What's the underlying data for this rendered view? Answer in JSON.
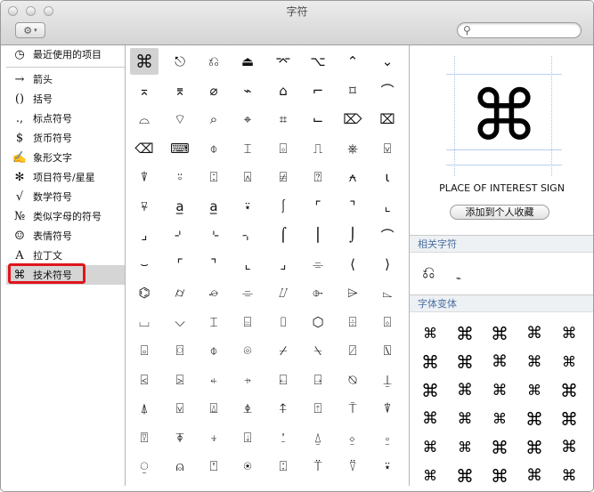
{
  "window": {
    "title": "字符"
  },
  "toolbar": {
    "gear_icon": "⚙",
    "caret": "▾",
    "search_placeholder": ""
  },
  "sidebar": {
    "items": [
      {
        "icon": "◷",
        "label": "最近使用的项目",
        "name": "recent"
      },
      {
        "icon": "→",
        "label": "箭头",
        "name": "arrows"
      },
      {
        "icon": "()",
        "label": "括号",
        "name": "brackets"
      },
      {
        "icon": ".,",
        "label": "标点符号",
        "name": "punctuation"
      },
      {
        "icon": "$",
        "label": "货币符号",
        "name": "currency"
      },
      {
        "icon": "✍",
        "label": "象形文字",
        "name": "pictographs"
      },
      {
        "icon": "✻",
        "label": "项目符号/星星",
        "name": "bullets-stars"
      },
      {
        "icon": "√",
        "label": "数学符号",
        "name": "math"
      },
      {
        "icon": "№",
        "label": "类似字母的符号",
        "name": "letterlike"
      },
      {
        "icon": "☺",
        "label": "表情符号",
        "name": "emoticons"
      },
      {
        "icon": "A",
        "label": "拉丁文",
        "name": "latin"
      },
      {
        "icon": "⌘",
        "label": "技术符号",
        "name": "technical"
      }
    ],
    "selected_index": 11
  },
  "grid": {
    "rows": [
      [
        "⌘",
        "⎋",
        "⎌",
        "⏏",
        "⌤",
        "⌥",
        "⌃",
        "⌄"
      ],
      [
        "⌅",
        "⌆",
        "⌀",
        "⌁",
        "⌂",
        "⌐",
        "⌑",
        "⌒"
      ],
      [
        "⌓",
        "⌔",
        "⌕",
        "⌖",
        "⌗",
        "⌙",
        "⌦",
        "⌧"
      ],
      [
        "⌫",
        "⌨",
        "⌽",
        "⌶",
        "⌺",
        "⎍",
        "⎈",
        "⍌"
      ],
      [
        "⍒",
        "⍤",
        "⍠",
        "⍓",
        "⍯",
        "⍰",
        "⍲",
        "⍳"
      ],
      [
        "⍫",
        "a̲",
        "a̲",
        "⍣",
        "⎰",
        "⌜",
        "⌝",
        "⌞"
      ],
      [
        "⌟",
        "⌏",
        "⌎",
        "⌍",
        "⌠",
        "⎮",
        "⌡",
        "⌒"
      ],
      [
        "⌣",
        "⌜",
        "⌝",
        "⌞",
        "⌟",
        "⌯",
        "⟨",
        "⟩"
      ],
      [
        "⌬",
        "⌭",
        "⌮",
        "⌯",
        "⌰",
        "⌱",
        "⌲",
        "⌳"
      ],
      [
        "⌴",
        "⌵",
        "⌶",
        "⌸",
        "⌷",
        "⬡",
        "⌹",
        "⌺"
      ],
      [
        "⌻",
        "⌼",
        "⌽",
        "⌾",
        "⌿",
        "⍀",
        "⍁",
        "⍂"
      ],
      [
        "⍃",
        "⍄",
        "⍅",
        "⍆",
        "⍇",
        "⍈",
        "⍉",
        "⍊"
      ],
      [
        "⍋",
        "⍌",
        "⍍",
        "⍎",
        "⍏",
        "⍐",
        "⍑",
        "⍒"
      ],
      [
        "⍔",
        "⍕",
        "⍖",
        "⍗",
        "⍘",
        "⍙",
        "⍚",
        "⍛"
      ],
      [
        "⍜",
        "⍝",
        "⍞",
        "⍟",
        "⍠",
        "⍡",
        "⍢",
        "⍣"
      ]
    ],
    "selected": "⌘"
  },
  "detail": {
    "glyph": "⌘",
    "name": "PLACE OF INTEREST SIGN",
    "fav_button": "添加到个人收藏",
    "related_header": "相关字符",
    "related": [
      "⎌",
      "⌁"
    ],
    "variants_header": "字体变体",
    "variants": [
      "⌘",
      "⌘",
      "⌘",
      "⌘",
      "⌘",
      "⌘",
      "⌘",
      "⌘",
      "⌘",
      "⌘",
      "⌘",
      "⌘",
      "⌘",
      "⌘",
      "⌘",
      "⌘",
      "⌘",
      "⌘",
      "⌘",
      "⌘",
      "⌘",
      "⌘",
      "⌘",
      "⌘",
      "⌘",
      "⌘",
      "⌘",
      "⌘",
      "⌘",
      "⌘"
    ]
  }
}
